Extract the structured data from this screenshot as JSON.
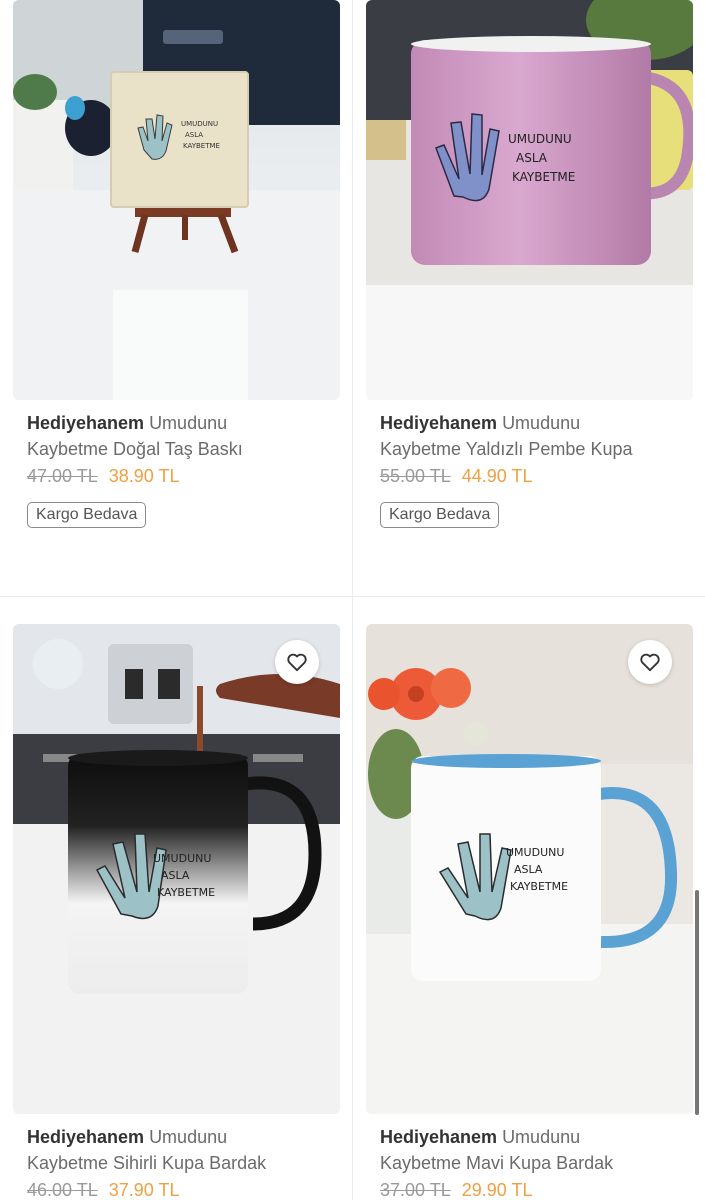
{
  "products": [
    {
      "brand": "Hediyehanem",
      "name_line1": "Umudunu",
      "name_line2": "Kaybetme Doğal Taş Baskı",
      "old_price": "47.00 TL",
      "new_price": "38.90 TL",
      "badge": "Kargo Bedava",
      "print_text": [
        "UMUDUNU",
        "ASLA",
        "KAYBETME"
      ]
    },
    {
      "brand": "Hediyehanem",
      "name_line1": "Umudunu",
      "name_line2": "Kaybetme Yaldızlı Pembe Kupa",
      "old_price": "55.00 TL",
      "new_price": "44.90 TL",
      "badge": "Kargo Bedava",
      "print_text": [
        "UMUDUNU",
        "ASLA",
        "KAYBETME"
      ]
    },
    {
      "brand": "Hediyehanem",
      "name_line1": "Umudunu",
      "name_line2": "Kaybetme Sihirli Kupa Bardak",
      "old_price": "46.00 TL",
      "new_price": "37.90 TL",
      "print_text": [
        "UMUDUNU",
        "ASLA",
        "KAYBETME"
      ]
    },
    {
      "brand": "Hediyehanem",
      "name_line1": "Umudunu",
      "name_line2": "Kaybetme Mavi Kupa Bardak",
      "old_price": "37.00 TL",
      "new_price": "29.90 TL",
      "print_text": [
        "UMUDUNU",
        "ASLA",
        "KAYBETME"
      ]
    }
  ],
  "colors": {
    "brand_text": "#333333",
    "name_text": "#6b6b6b",
    "old_price": "#9a9a9a",
    "new_price": "#f0a040"
  }
}
